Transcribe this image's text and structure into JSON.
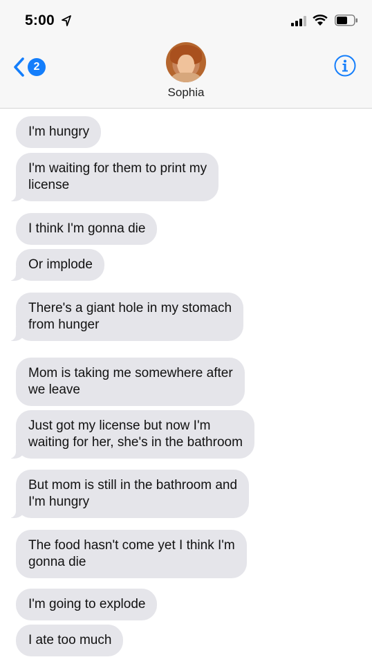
{
  "status_bar": {
    "time": "5:00"
  },
  "header": {
    "back_badge": "2",
    "contact_name": "Sophia"
  },
  "messages": [
    "I'm hungry",
    "I'm waiting for them to print my\nlicense",
    "I think I'm gonna die",
    "Or implode",
    "There's a giant hole in my stomach\nfrom hunger",
    "Mom is taking me somewhere after\nwe leave",
    "Just got my license but now I'm\nwaiting for her, she's in the bathroom",
    "But mom is still in the bathroom and\nI'm hungry",
    "The food hasn't come yet I think I'm\ngonna die",
    "I'm going to explode",
    "I ate too much"
  ],
  "colors": {
    "accent": "#147efb",
    "bubble": "#e5e5ea",
    "header_bg": "#f7f7f7"
  }
}
